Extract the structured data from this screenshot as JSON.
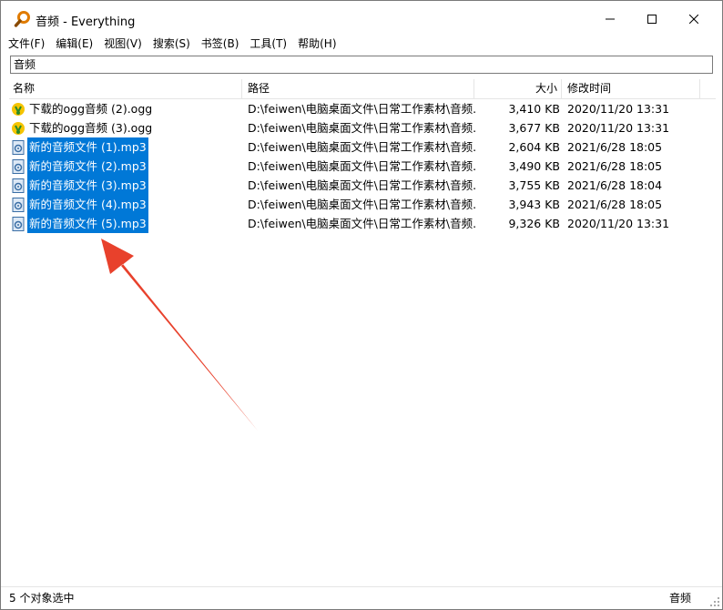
{
  "window": {
    "title": "音频 - Everything"
  },
  "menu": [
    {
      "label": "文件(F)",
      "name": "menu-file"
    },
    {
      "label": "编辑(E)",
      "name": "menu-edit"
    },
    {
      "label": "视图(V)",
      "name": "menu-view"
    },
    {
      "label": "搜索(S)",
      "name": "menu-search"
    },
    {
      "label": "书签(B)",
      "name": "menu-bookmarks"
    },
    {
      "label": "工具(T)",
      "name": "menu-tools"
    },
    {
      "label": "帮助(H)",
      "name": "menu-help"
    }
  ],
  "search": {
    "value": "音频"
  },
  "columns": {
    "name": "名称",
    "path": "路径",
    "size": "大小",
    "modified": "修改时间"
  },
  "files": [
    {
      "name": "下载的ogg音频 (2).ogg",
      "path": "D:\\feiwen\\电脑桌面文件\\日常工作素材\\音频...",
      "size": "3,410 KB",
      "modified": "2020/11/20 13:31",
      "type": "ogg",
      "selected": false
    },
    {
      "name": "下载的ogg音频 (3).ogg",
      "path": "D:\\feiwen\\电脑桌面文件\\日常工作素材\\音频...",
      "size": "3,677 KB",
      "modified": "2020/11/20 13:31",
      "type": "ogg",
      "selected": false
    },
    {
      "name": "新的音频文件 (1).mp3",
      "path": "D:\\feiwen\\电脑桌面文件\\日常工作素材\\音频...",
      "size": "2,604 KB",
      "modified": "2021/6/28 18:05",
      "type": "mp3",
      "selected": true
    },
    {
      "name": "新的音频文件 (2).mp3",
      "path": "D:\\feiwen\\电脑桌面文件\\日常工作素材\\音频...",
      "size": "3,490 KB",
      "modified": "2021/6/28 18:05",
      "type": "mp3",
      "selected": true
    },
    {
      "name": "新的音频文件 (3).mp3",
      "path": "D:\\feiwen\\电脑桌面文件\\日常工作素材\\音频...",
      "size": "3,755 KB",
      "modified": "2021/6/28 18:04",
      "type": "mp3",
      "selected": true
    },
    {
      "name": "新的音频文件 (4).mp3",
      "path": "D:\\feiwen\\电脑桌面文件\\日常工作素材\\音频...",
      "size": "3,943 KB",
      "modified": "2021/6/28 18:05",
      "type": "mp3",
      "selected": true
    },
    {
      "name": "新的音频文件 (5).mp3",
      "path": "D:\\feiwen\\电脑桌面文件\\日常工作素材\\音频...",
      "size": "9,326 KB",
      "modified": "2020/11/20 13:31",
      "type": "mp3",
      "selected": true
    }
  ],
  "status": {
    "left": "5 个对象选中",
    "right": "音频"
  },
  "colors": {
    "selection": "#0078d7",
    "arrow": "#e8412c",
    "ogg_icon": "#f5c400",
    "mp3_icon": "#3a6ea5"
  }
}
